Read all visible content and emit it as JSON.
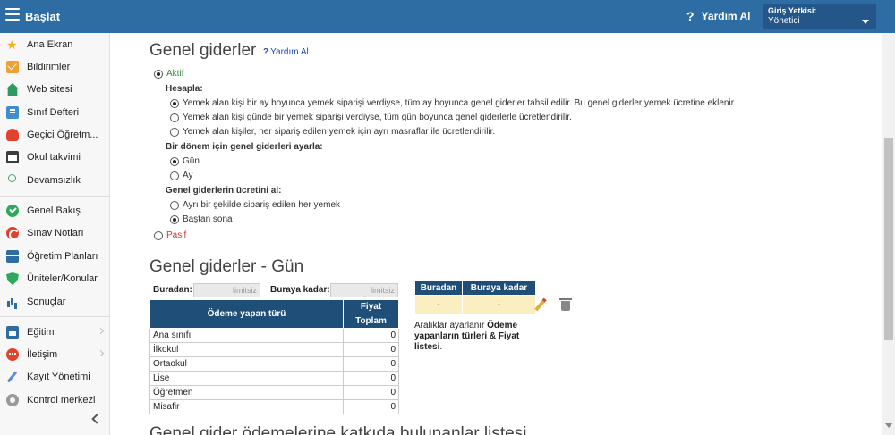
{
  "topbar": {
    "brand": "Başlat",
    "help": "Yardım Al",
    "role_label": "Giriş Yetkisi:",
    "role_value": "Yönetici"
  },
  "sidebar": {
    "items": [
      {
        "label": "Ana Ekran",
        "icon": "star-icon"
      },
      {
        "label": "Bildirimler",
        "icon": "mail-icon"
      },
      {
        "label": "Web sitesi",
        "icon": "home-icon"
      },
      {
        "label": "Sınıf Defteri",
        "icon": "book-icon"
      },
      {
        "label": "Geçici Öğretm...",
        "icon": "user-icon"
      },
      {
        "label": "Okul takvimi",
        "icon": "calendar-icon"
      },
      {
        "label": "Devamsızlık",
        "icon": "person-icon"
      },
      {
        "label": "Genel Bakış",
        "icon": "check-icon"
      },
      {
        "label": "Sınav Notları",
        "icon": "chart-icon"
      },
      {
        "label": "Öğretim Planları",
        "icon": "briefcase-icon"
      },
      {
        "label": "Üniteler/Konular",
        "icon": "shield-icon"
      },
      {
        "label": "Sonuçlar",
        "icon": "bars-icon"
      },
      {
        "label": "Eğitim",
        "icon": "school-icon"
      },
      {
        "label": "İletişim",
        "icon": "chat-icon"
      },
      {
        "label": "Kayıt Yönetimi",
        "icon": "pen-icon"
      },
      {
        "label": "Kontrol merkezi",
        "icon": "gear-icon"
      }
    ]
  },
  "section1": {
    "title": "Genel giderler",
    "help": "Yardım Al",
    "active": "Aktif",
    "calc_label": "Hesapla:",
    "calc_options": [
      "Yemek alan kişi bir ay boyunca yemek siparişi verdiyse, tüm ay boyunca genel giderler tahsil edilir. Bu genel giderler yemek ücretine eklenir.",
      "Yemek alan kişi günde bir yemek siparişi verdiyse, tüm gün boyunca genel giderlerle ücretlendirilir.",
      "Yemek alan kişiler, her sipariş edilen yemek için ayrı masraflar ile ücretlendirilir."
    ],
    "period_label": "Bir dönem için genel giderleri ayarla:",
    "period_options": [
      "Gün",
      "Ay"
    ],
    "fee_label": "Genel giderlerin ücretini al:",
    "fee_options": [
      "Ayrı bir şekilde sipariş edilen her yemek",
      "Baştan sona"
    ],
    "passive": "Pasif"
  },
  "section2": {
    "title": "Genel giderler - Gün",
    "from_label": "Buradan:",
    "to_label": "Buraya kadar:",
    "placeholder": "limitsiz",
    "table": {
      "col_type": "Ödeme yapan türü",
      "col_price": "Fiyat",
      "col_total": "Toplam",
      "rows": [
        {
          "type": "Ana sınıfı",
          "value": "0"
        },
        {
          "type": "İlkokul",
          "value": "0"
        },
        {
          "type": "Ortaokul",
          "value": "0"
        },
        {
          "type": "Lise",
          "value": "0"
        },
        {
          "type": "Öğretmen",
          "value": "0"
        },
        {
          "type": "Misafir",
          "value": "0"
        }
      ]
    },
    "interval": {
      "col_from": "Buradan",
      "col_to": "Buraya kadar",
      "from": "-",
      "to": "-"
    },
    "note_pre": "Aralıklar ayarlanır ",
    "note_bold": "Ödeme yapanların türleri & Fiyat listesi",
    "note_post": "."
  },
  "section3": {
    "title": "Genel gider ödemelerine katkıda bulunanlar listesi"
  }
}
